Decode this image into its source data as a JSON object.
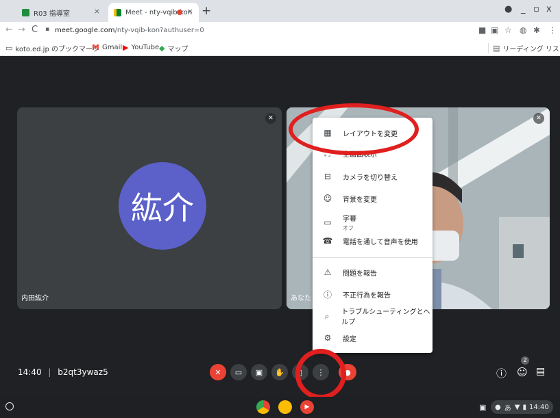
{
  "browser": {
    "tabs": [
      {
        "title": "R03 指導室",
        "close": "×"
      },
      {
        "title": "Meet - nty-vqib-kon",
        "close": "×"
      }
    ],
    "new_tab": "+",
    "url_host": "meet.google.com",
    "url_path": "/nty-vqib-kon?authuser=0",
    "bookmarks": [
      {
        "label": "koto.ed.jp のブックマーク"
      },
      {
        "label": "Gmail"
      },
      {
        "label": "YouTube"
      },
      {
        "label": "マップ"
      }
    ],
    "reading_list": "リーディング リスト"
  },
  "meet": {
    "left_tile": {
      "avatar_text": "紘介",
      "name": "内田紘介"
    },
    "right_tile": {
      "name": "あなた"
    },
    "menu": [
      {
        "label": "レイアウトを変更",
        "icon": "layout-icon"
      },
      {
        "label": "全画面表示",
        "icon": "fullscreen-icon"
      },
      {
        "label": "カメラを切り替え",
        "icon": "switch-camera-icon"
      },
      {
        "label": "背景を変更",
        "icon": "background-icon"
      },
      {
        "label": "字幕",
        "sub": "オフ",
        "icon": "captions-icon"
      },
      {
        "label": "電話を通して音声を使用",
        "icon": "phone-icon"
      },
      {
        "label": "問題を報告",
        "icon": "report-icon"
      },
      {
        "label": "不正行為を報告",
        "icon": "abuse-icon"
      },
      {
        "label": "トラブルシューティングとヘルプ",
        "icon": "troubleshoot-icon"
      },
      {
        "label": "設定",
        "icon": "settings-icon"
      }
    ],
    "time": "14:40",
    "meeting_code": "b2qt3ywaz5",
    "participants_count": "2"
  },
  "shelf": {
    "clock": "14:40",
    "ime": "あ"
  },
  "colors": {
    "accent_red": "#ea4335",
    "avatar": "#5b61c8",
    "annotation": "#e01f1f"
  }
}
